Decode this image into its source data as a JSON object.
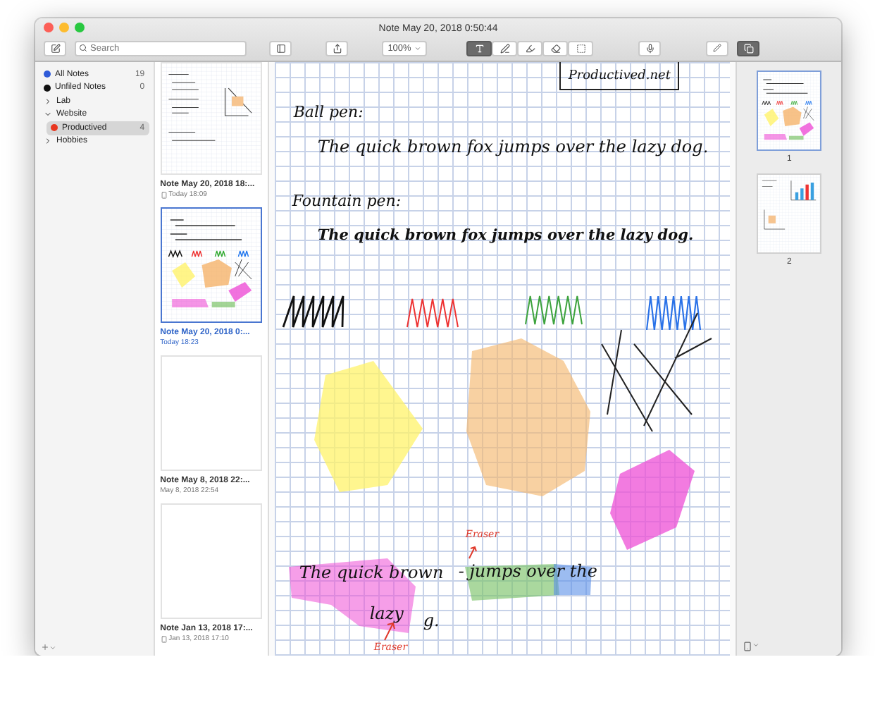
{
  "window": {
    "title": "Note May 20, 2018 0:50:44"
  },
  "toolbar": {
    "search_placeholder": "Search",
    "zoom": "100%",
    "tools": [
      {
        "kind": "text",
        "selected": true
      },
      {
        "kind": "pen",
        "selected": false
      },
      {
        "kind": "highlighter",
        "selected": false
      },
      {
        "kind": "eraser",
        "selected": false
      },
      {
        "kind": "select",
        "selected": false
      }
    ],
    "pages_button": {
      "selected": true
    }
  },
  "sidebar": {
    "items": [
      {
        "kind": "notebook",
        "label": "All Notes",
        "count": "19",
        "color": "#2f5bd8",
        "selected": false
      },
      {
        "kind": "notebook",
        "label": "Unfiled Notes",
        "count": "0",
        "color": "#111111",
        "selected": false
      },
      {
        "kind": "group",
        "label": "Lab",
        "expanded": false,
        "selected": false
      },
      {
        "kind": "group",
        "label": "Website",
        "expanded": true,
        "selected": false,
        "children": [
          {
            "kind": "notebook",
            "label": "Productived",
            "count": "4",
            "color": "#e8361f",
            "selected": true
          }
        ]
      },
      {
        "kind": "group",
        "label": "Hobbies",
        "expanded": false,
        "selected": false
      }
    ]
  },
  "notes": [
    {
      "title": "Note May 20, 2018 18:...",
      "date": "Today 18:09",
      "synced": true,
      "kind": "outline",
      "selected": false
    },
    {
      "title": "Note May 20, 2018 0:...",
      "date": "Today 18:23",
      "synced": false,
      "kind": "ink",
      "selected": true
    },
    {
      "title": "Note May 8, 2018 22:...",
      "date": "May 8, 2018 22:54",
      "synced": false,
      "kind": "blank",
      "selected": false
    },
    {
      "title": "Note Jan 13, 2018 17:...",
      "date": "Jan 13, 2018 17:10",
      "synced": true,
      "kind": "blank",
      "selected": false
    }
  ],
  "canvas": {
    "texts": [
      {
        "kind": "boxed",
        "text": "Productived.net"
      },
      {
        "kind": "label",
        "text": "Ball pen:"
      },
      {
        "kind": "line",
        "text": "The quick brown fox jumps over the lazy dog."
      },
      {
        "kind": "label",
        "text": "Fountain pen:"
      },
      {
        "kind": "bold_line",
        "text": "The quick brown fox jumps over the lazy dog."
      },
      {
        "kind": "line",
        "text": "The quick brown"
      },
      {
        "kind": "line",
        "text": "- jumps over the"
      },
      {
        "kind": "line",
        "text": "lazy"
      },
      {
        "kind": "line",
        "text": "g."
      },
      {
        "kind": "note",
        "text": "Eraser"
      },
      {
        "kind": "note",
        "text": "Eraser"
      }
    ]
  },
  "pages": [
    {
      "label": "1",
      "selected": true,
      "kind": "ink"
    },
    {
      "label": "2",
      "selected": false,
      "kind": "chart"
    }
  ]
}
